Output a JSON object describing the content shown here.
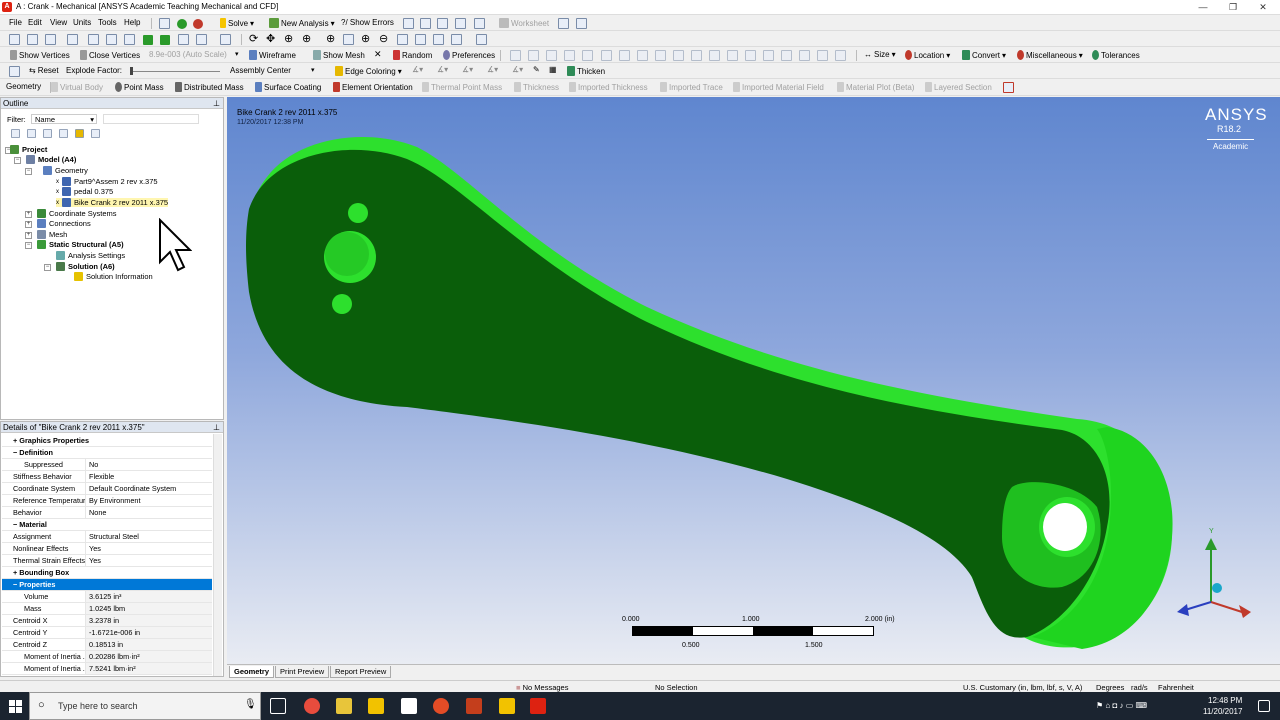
{
  "window": {
    "title": "A : Crank - Mechanical [ANSYS Academic Teaching Mechanical and CFD]"
  },
  "menu": [
    "File",
    "Edit",
    "View",
    "Units",
    "Tools",
    "Help"
  ],
  "toolbar1": {
    "solve": "Solve",
    "new_analysis": "New Analysis",
    "show_errors": "?/ Show Errors",
    "worksheet": "Worksheet"
  },
  "toolbar3": {
    "show_vertices": "Show Vertices",
    "close_vertices": "Close Vertices",
    "scale": "8.9e-003 (Auto Scale)",
    "wireframe": "Wireframe",
    "show_mesh": "Show Mesh",
    "random": "Random",
    "preferences": "Preferences",
    "size": "Size",
    "location": "Location",
    "convert": "Convert",
    "miscellaneous": "Miscellaneous",
    "tolerances": "Tolerances"
  },
  "toolbar4": {
    "reset": "Reset",
    "explode_factor": "Explode Factor:",
    "assembly_center": "Assembly Center",
    "edge_coloring": "Edge Coloring",
    "thicken": "Thicken"
  },
  "context": {
    "geometry": "Geometry",
    "virtual_body": "Virtual Body",
    "point_mass": "Point Mass",
    "distributed_mass": "Distributed Mass",
    "surface_coating": "Surface Coating",
    "element_orientation": "Element Orientation",
    "thermal_point_mass": "Thermal Point Mass",
    "thickness": "Thickness",
    "imported_thickness": "Imported Thickness",
    "imported_trace": "Imported Trace",
    "imported_material_field": "Imported Material Field",
    "material_plot": "Material Plot (Beta)",
    "layered_section": "Layered Section"
  },
  "outline": {
    "header": "Outline",
    "filter_label": "Filter:",
    "filter_value": "Name",
    "tree": {
      "project": "Project",
      "model": "Model (A4)",
      "geometry": "Geometry",
      "part1": "Part9^Assem 2 rev x.375",
      "part2": "pedal 0.375",
      "part3": "Bike Crank 2 rev 2011 x.375",
      "coord": "Coordinate Systems",
      "connections": "Connections",
      "mesh": "Mesh",
      "static": "Static Structural (A5)",
      "analysis_settings": "Analysis Settings",
      "solution": "Solution (A6)",
      "solution_info": "Solution Information"
    }
  },
  "details": {
    "header": "Details of \"Bike Crank 2 rev 2011 x.375\"",
    "graphics": "Graphics Properties",
    "definition": "Definition",
    "suppressed": [
      "Suppressed",
      "No"
    ],
    "stiffness": [
      "Stiffness Behavior",
      "Flexible"
    ],
    "coord": [
      "Coordinate System",
      "Default Coordinate System"
    ],
    "reftemp": [
      "Reference Temperature",
      "By Environment"
    ],
    "behavior": [
      "Behavior",
      "None"
    ],
    "material": "Material",
    "assignment": [
      "Assignment",
      "Structural Steel"
    ],
    "nonlinear": [
      "Nonlinear Effects",
      "Yes"
    ],
    "thermal": [
      "Thermal Strain Effects",
      "Yes"
    ],
    "bbox": "Bounding Box",
    "properties": "Properties",
    "volume": [
      "Volume",
      "3.6125 in³"
    ],
    "mass": [
      "Mass",
      "1.0245 lbm"
    ],
    "cx": [
      "Centroid X",
      "3.2378 in"
    ],
    "cy": [
      "Centroid Y",
      "-1.6721e-006 in"
    ],
    "cz": [
      "Centroid Z",
      "0.18513 in"
    ],
    "moi1": [
      "Moment of Inertia ...",
      "0.20286 lbm·in²"
    ],
    "moi2": [
      "Moment of Inertia ...",
      "7.5241 lbm·in²"
    ]
  },
  "viewport": {
    "model_name": "Bike Crank 2 rev 2011 x.375",
    "date": "11/20/2017 12:38 PM",
    "brand": "ANSYS",
    "release": "R18.2",
    "edition": "Academic",
    "scale_top": [
      "0.000",
      "1.000",
      "2.000 (in)"
    ],
    "scale_bottom": [
      "0.500",
      "1.500"
    ],
    "body_color": "#0a5e0a",
    "edge_color": "#2de02d"
  },
  "view_tabs": [
    "Geometry",
    "Print Preview",
    "Report Preview"
  ],
  "status": {
    "messages": "No Messages",
    "selection": "No Selection",
    "units": "U.S. Customary (in, lbm, lbf, s, V, A)",
    "degrees": "Degrees",
    "rads": "rad/s",
    "temp": "Fahrenheit"
  },
  "taskbar": {
    "search": "Type here to search",
    "time": "12:48 PM",
    "date": "11/20/2017"
  }
}
